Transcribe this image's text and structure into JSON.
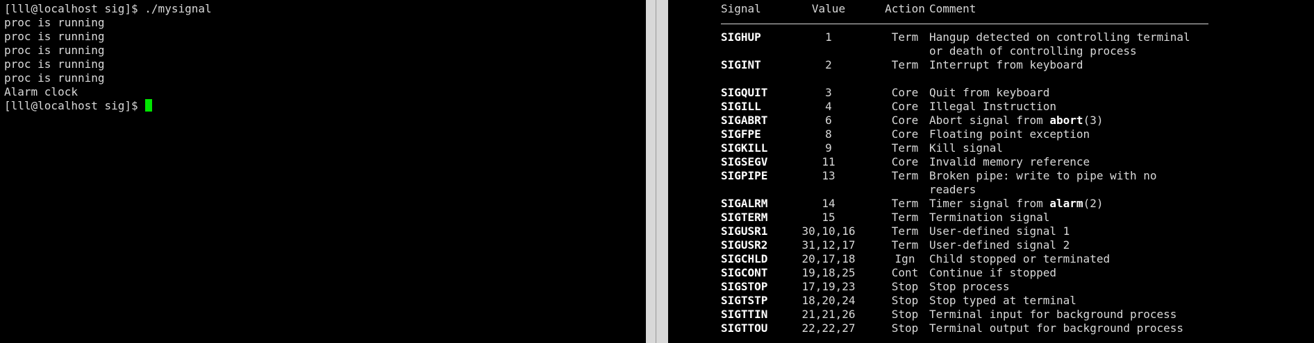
{
  "colors": {
    "cursor": "#00e600",
    "text": "#d9d9d9"
  },
  "terminal": {
    "lines": [
      "[lll@localhost sig]$ ./mysignal",
      "proc is running",
      "proc is running",
      "proc is running",
      "proc is running",
      "proc is running",
      "Alarm clock"
    ],
    "prompt": "[lll@localhost sig]$ "
  },
  "manpage": {
    "headers": {
      "signal": "Signal",
      "value": "Value",
      "action": "Action",
      "comment": "Comment"
    },
    "rows": [
      {
        "signal": "SIGHUP",
        "value": "1",
        "action": "Term",
        "comment": "Hangup detected on controlling terminal"
      },
      {
        "signal": "",
        "value": "",
        "action": "",
        "comment": "or death of controlling process"
      },
      {
        "signal": "SIGINT",
        "value": "2",
        "action": "Term",
        "comment": "Interrupt from keyboard"
      },
      {
        "signal": "SIGQUIT",
        "value": "3",
        "action": "Core",
        "comment": "Quit from keyboard"
      },
      {
        "signal": "SIGILL",
        "value": "4",
        "action": "Core",
        "comment": "Illegal Instruction"
      },
      {
        "signal": "SIGABRT",
        "value": "6",
        "action": "Core",
        "comment": "Abort signal from ",
        "bold": "abort",
        "after": "(3)"
      },
      {
        "signal": "SIGFPE",
        "value": "8",
        "action": "Core",
        "comment": "Floating point exception"
      },
      {
        "signal": "SIGKILL",
        "value": "9",
        "action": "Term",
        "comment": "Kill signal"
      },
      {
        "signal": "SIGSEGV",
        "value": "11",
        "action": "Core",
        "comment": "Invalid memory reference"
      },
      {
        "signal": "SIGPIPE",
        "value": "13",
        "action": "Term",
        "comment": "Broken pipe: write to pipe with no"
      },
      {
        "signal": "",
        "value": "",
        "action": "",
        "comment": "readers"
      },
      {
        "signal": "SIGALRM",
        "value": "14",
        "action": "Term",
        "comment": "Timer signal from ",
        "bold": "alarm",
        "after": "(2)"
      },
      {
        "signal": "SIGTERM",
        "value": "15",
        "action": "Term",
        "comment": "Termination signal"
      },
      {
        "signal": "SIGUSR1",
        "value": "30,10,16",
        "action": "Term",
        "comment": "User-defined signal 1"
      },
      {
        "signal": "SIGUSR2",
        "value": "31,12,17",
        "action": "Term",
        "comment": "User-defined signal 2"
      },
      {
        "signal": "SIGCHLD",
        "value": "20,17,18",
        "action": "Ign",
        "comment": "Child stopped or terminated"
      },
      {
        "signal": "SIGCONT",
        "value": "19,18,25",
        "action": "Cont",
        "comment": "Continue if stopped"
      },
      {
        "signal": "SIGSTOP",
        "value": "17,19,23",
        "action": "Stop",
        "comment": "Stop process"
      },
      {
        "signal": "SIGTSTP",
        "value": "18,20,24",
        "action": "Stop",
        "comment": "Stop typed at terminal"
      },
      {
        "signal": "SIGTTIN",
        "value": "21,21,26",
        "action": "Stop",
        "comment": "Terminal input for background process"
      },
      {
        "signal": "SIGTTOU",
        "value": "22,22,27",
        "action": "Stop",
        "comment": "Terminal output for background process"
      }
    ]
  }
}
